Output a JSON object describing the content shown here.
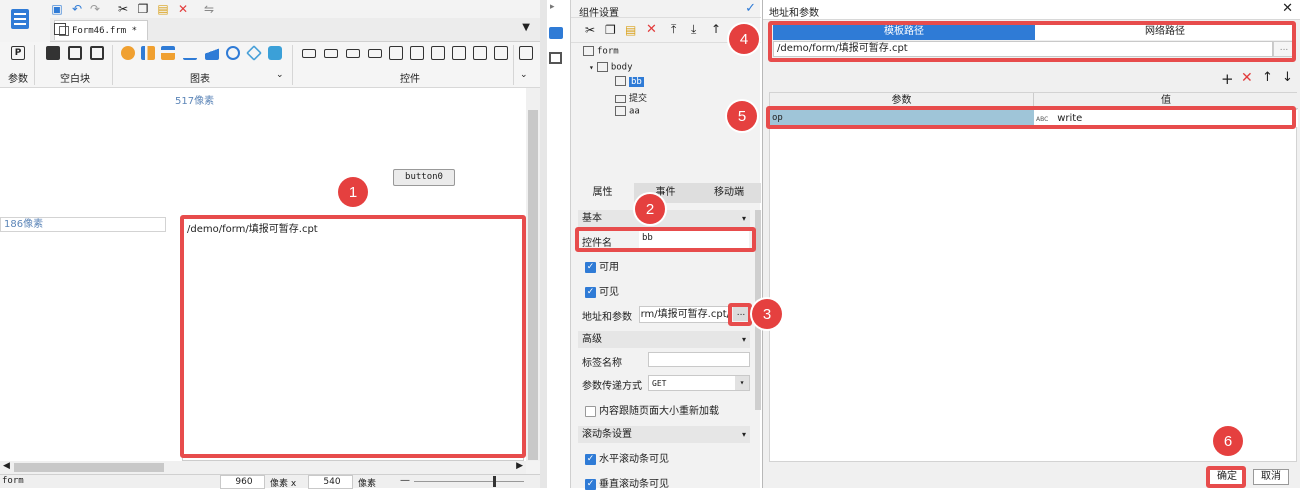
{
  "designer": {
    "tab_title": "Form46.frm *",
    "groups": [
      "参数",
      "空白块",
      "图表",
      "控件"
    ],
    "ruler_top": "517像素",
    "ruler_left": "186像素",
    "button_label": "button0",
    "frame_url": "/demo/form/填报可暂存.cpt",
    "status_label": "form",
    "width_value": "960",
    "width_unit": "像素 x",
    "height_value": "540",
    "height_unit": "像素"
  },
  "component_panel": {
    "title": "组件设置",
    "tree": [
      "form",
      "body",
      "bb",
      "提交",
      "aa"
    ],
    "tabs": [
      "属性",
      "事件",
      "移动端"
    ],
    "section_basic": "基本",
    "name_label": "控件名",
    "name_value": "bb",
    "enabled_label": "可用",
    "visible_label": "可见",
    "url_label": "地址和参数",
    "url_value": "/form/填报可暂存.cpt",
    "more_btn": "...",
    "section_advanced": "高级",
    "tag_label": "标签名称",
    "param_method_label": "参数传递方式",
    "param_method_value": "GET",
    "reload_label": "内容跟随页面大小重新加载",
    "section_scroll": "滚动条设置",
    "hscroll_label": "水平滚动条可见",
    "vscroll_label": "垂直滚动条可见"
  },
  "dialog": {
    "title": "地址和参数",
    "tab_template": "模板路径",
    "tab_network": "网络路径",
    "path_value": "/demo/form/填报可暂存.cpt",
    "path_btn": "...",
    "col_param": "参数",
    "col_value": "值",
    "row_param": "op",
    "row_type": "ABC",
    "row_value": "write",
    "ok": "确定",
    "cancel": "取消"
  },
  "badges": [
    "1",
    "2",
    "3",
    "4",
    "5",
    "6"
  ],
  "colors": {
    "accent": "#2f7bd6",
    "highlight": "#e74c4c",
    "badge": "#e5403f"
  }
}
